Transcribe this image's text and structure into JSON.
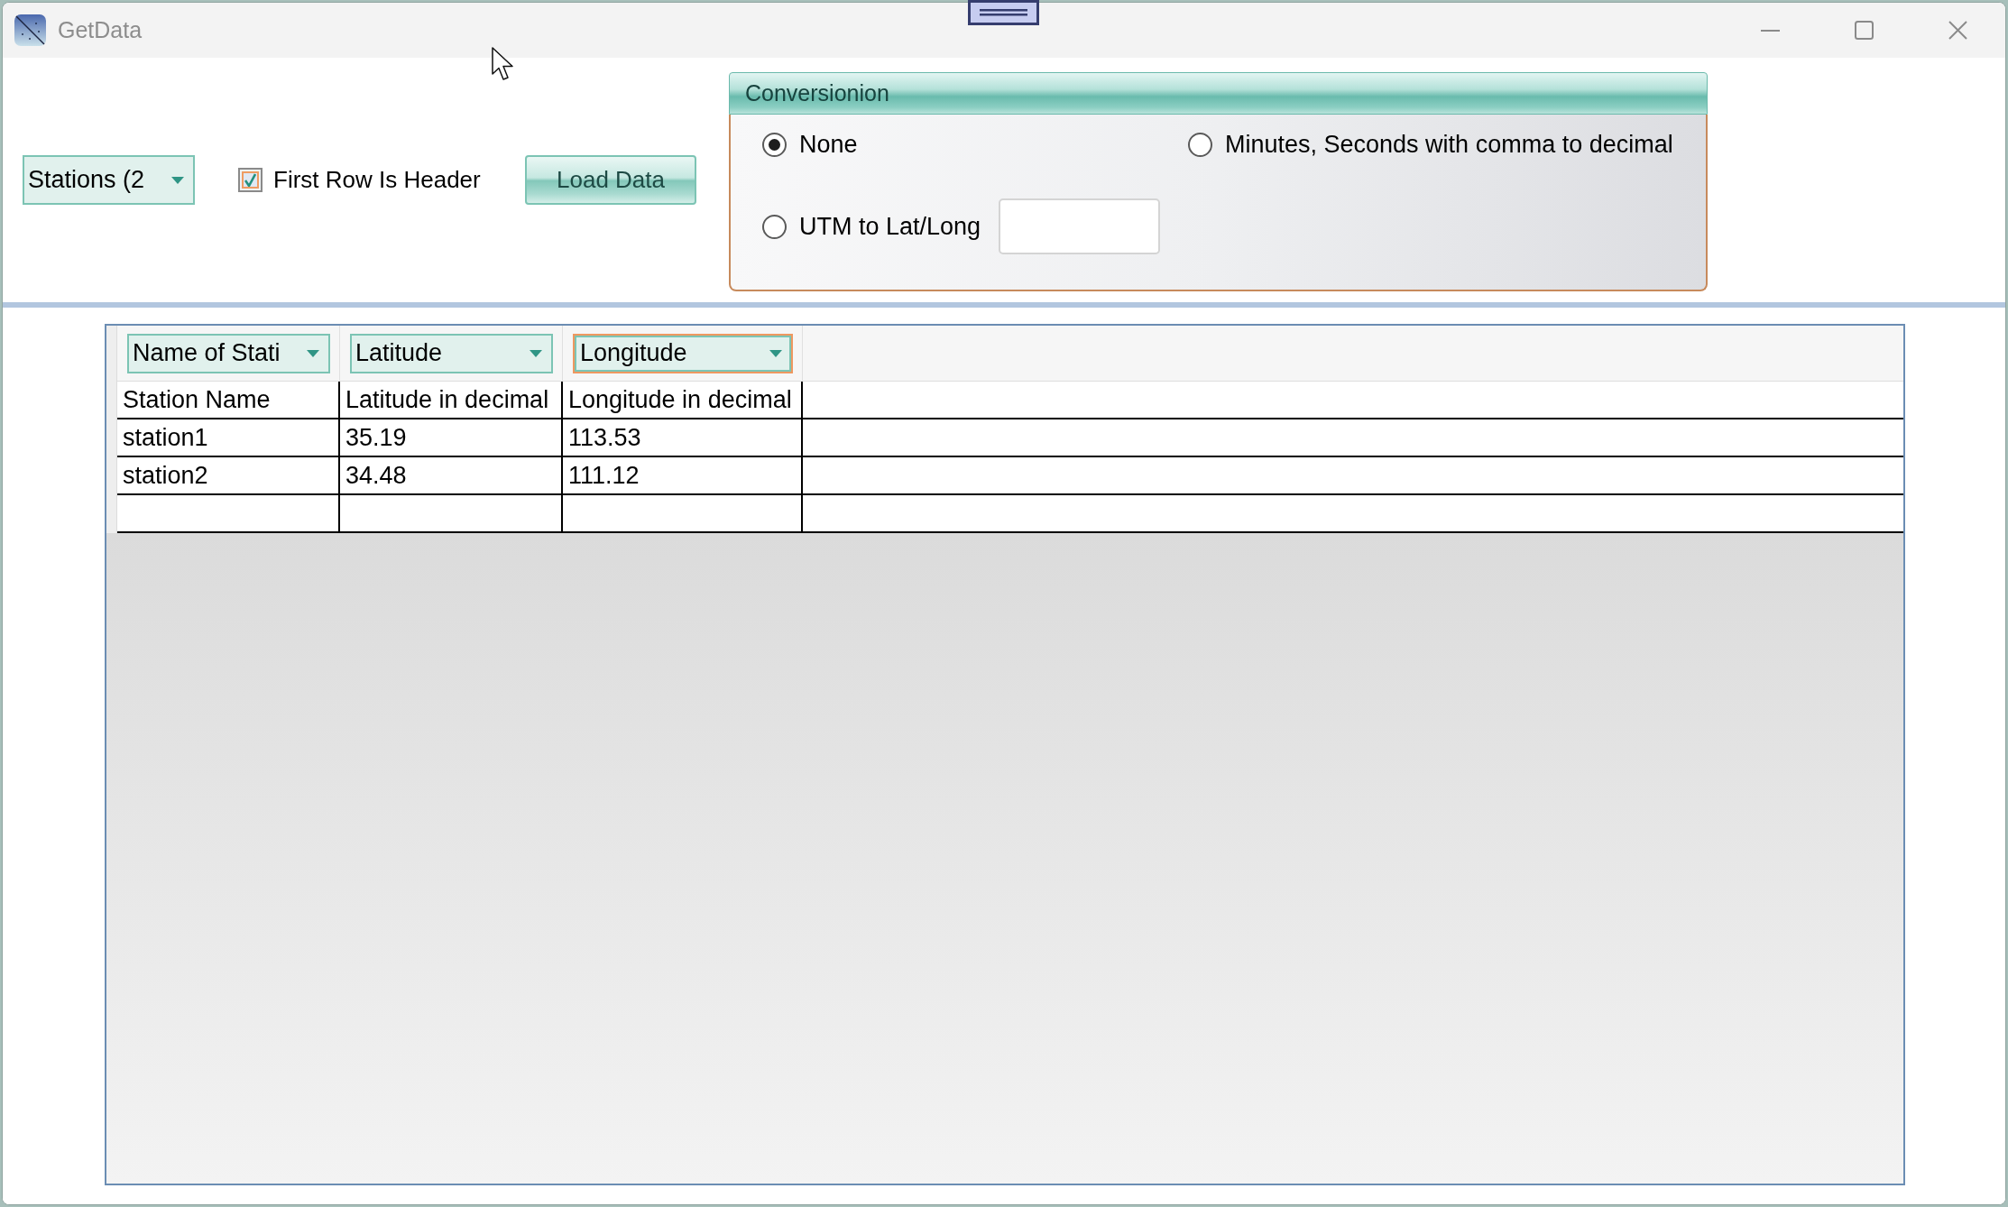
{
  "window": {
    "title": "GetData"
  },
  "toolbar": {
    "source": {
      "value": "Stations (2"
    },
    "first_row_is_header": {
      "label": "First Row Is Header",
      "checked": true
    },
    "load_button": {
      "label": "Load Data"
    }
  },
  "conversion": {
    "title": "Conversionion",
    "options": [
      {
        "label": "None",
        "selected": true,
        "kind": "radio"
      },
      {
        "label": "Minutes, Seconds with comma to decimal",
        "selected": false,
        "kind": "radio"
      },
      {
        "label": "UTM to Lat/Long",
        "selected": false,
        "kind": "radio_with_field"
      }
    ]
  },
  "grid": {
    "column_mappings": [
      {
        "value": "Name of Stati",
        "focused": false
      },
      {
        "value": "Latitude",
        "focused": false
      },
      {
        "value": "Longitude",
        "focused": true
      }
    ],
    "rows": [
      [
        "Station Name",
        "Latitude in decimal",
        "Longitude in decimal"
      ],
      [
        "station1",
        "35.19",
        "113.53"
      ],
      [
        "station2",
        "34.48",
        "111.12"
      ]
    ],
    "blank_row": true
  }
}
